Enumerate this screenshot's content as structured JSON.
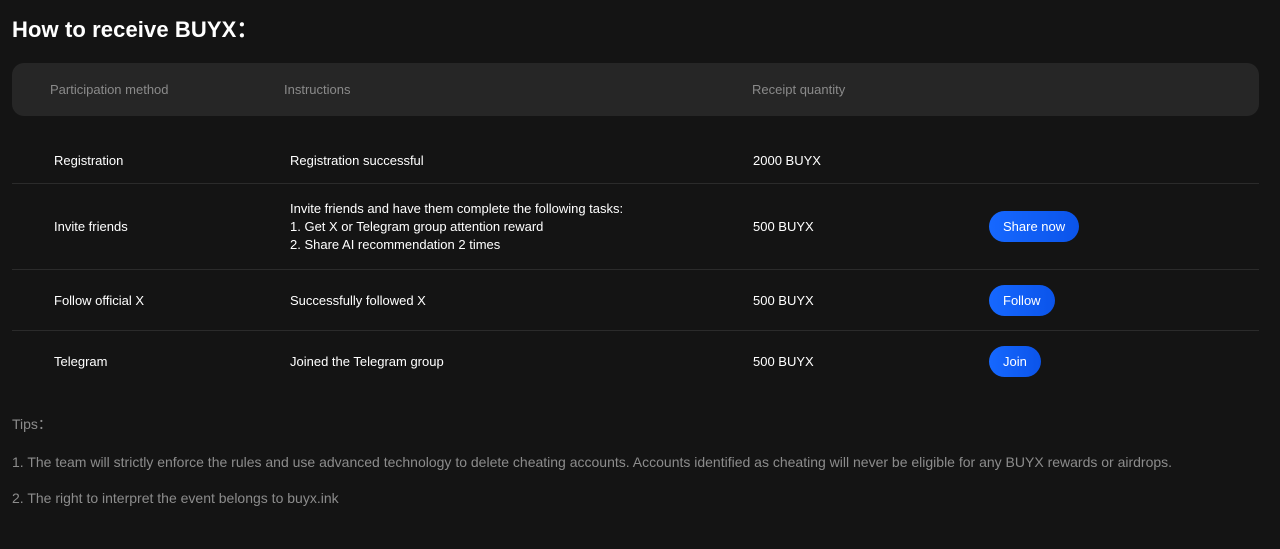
{
  "page": {
    "title": "How to receive BUYX："
  },
  "table": {
    "headers": [
      "Participation method",
      "Instructions",
      "Receipt quantity"
    ],
    "rows": [
      {
        "method": "Registration",
        "instructions": [
          "Registration successful"
        ],
        "quantity": "2000 BUYX",
        "action": ""
      },
      {
        "method": "Invite friends",
        "instructions": [
          "Invite friends and have them complete the following tasks:",
          "1. Get X or Telegram group attention reward",
          "2. Share AI recommendation 2 times"
        ],
        "quantity": "500 BUYX",
        "action": "Share now"
      },
      {
        "method": "Follow official X",
        "instructions": [
          "Successfully followed X"
        ],
        "quantity": "500 BUYX",
        "action": "Follow"
      },
      {
        "method": "Telegram",
        "instructions": [
          "Joined the Telegram group"
        ],
        "quantity": "500 BUYX",
        "action": "Join"
      }
    ]
  },
  "tips": {
    "title": "Tips：",
    "items": [
      "1. The team will strictly enforce the rules and use advanced technology to delete cheating accounts. Accounts identified as cheating will never be eligible for any BUYX rewards or airdrops.",
      "2. The right to interpret the event belongs to buyx.ink"
    ]
  },
  "colors": {
    "background": "#141414",
    "header_bg": "#262626",
    "accent": "#1668ff",
    "muted_text": "#8c8c8c"
  }
}
